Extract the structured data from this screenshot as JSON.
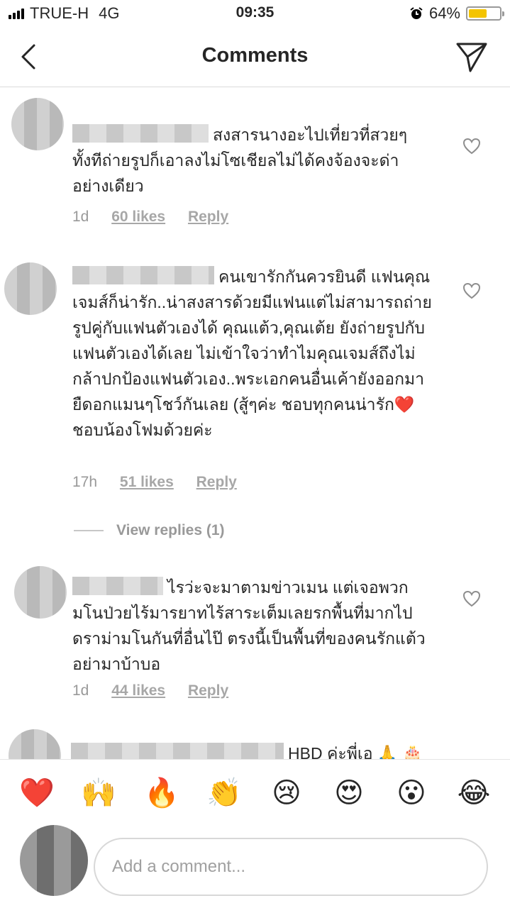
{
  "status": {
    "carrier": "TRUE-H",
    "network": "4G",
    "time": "09:35",
    "battery": "64%",
    "battery_level": 0.64
  },
  "header": {
    "title": "Comments"
  },
  "comments": [
    {
      "text": "สงสารนางอะไปเที่ยวที่สวยๆทั้งทีถ่ายรูปก็เอาลงไม่โซเชียลไม่ได้คงจ้องจะด่าอย่างเดียว",
      "time": "1d",
      "likes": "60 likes",
      "reply": "Reply"
    },
    {
      "text": "คนเขารักกันควรยินดี แฟนคุณเจมส์ก็น่ารัก..น่าสงสารด้วยมีแฟนแต่ไม่สามารถถ่ายรูปคู่กับแฟนตัวเองได้  คุณแต้ว,คุณเต้ย ยังถ่ายรูปกับแฟนตัวเองได้เลย ไม่เข้าใจว่าทำไมคุณเจมส์ถึงไม่กล้าปกป้องแฟนตัวเอง..พระเอกคนอื่นเค้ายังออกมายืดอกแมนๆโชว์กันเลย (สู้ๆค่ะ ชอบทุกคนน่ารัก❤️ ชอบน้องโฟมด้วยค่ะ",
      "time": "17h",
      "likes": "51 likes",
      "reply": "Reply"
    },
    {
      "text": "ไรว่ะจะมาตามข่าวเมน แต่เจอพวกมโนป่วยไร้มารยาทไร้สาระเต็มเลยรกพื้นที่มากไปดราม่ามโนกันที่อื่นไป๊ ตรงนี้เป็นพื้นที่ของคนรักแต้ว อย่ามาบ้าบอ",
      "time": "1d",
      "likes": "44 likes",
      "reply": "Reply"
    },
    {
      "text": "HBD ค่ะพี่เอ 🙏 🎂"
    }
  ],
  "view_replies": "View replies (1)",
  "emoji_bar": [
    "❤️",
    "🙌",
    "🔥",
    "👏",
    "😢",
    "😍",
    "😮",
    "😂"
  ],
  "input": {
    "placeholder": "Add a comment..."
  }
}
